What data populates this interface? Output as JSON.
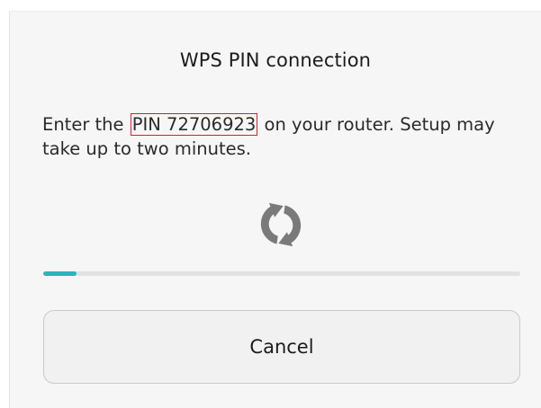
{
  "dialog": {
    "title": "WPS PIN connection",
    "message_before": "Enter the ",
    "pin_text": "PIN 72706923",
    "message_after": " on your router. Setup may take up to two minutes.",
    "spinner_icon": "refresh-icon",
    "progress_fraction": 0.07,
    "cancel_label": "Cancel"
  },
  "colors": {
    "accent": "#2bb5bc",
    "pin_border": "#d6202a",
    "icon": "#7a7a7a"
  }
}
